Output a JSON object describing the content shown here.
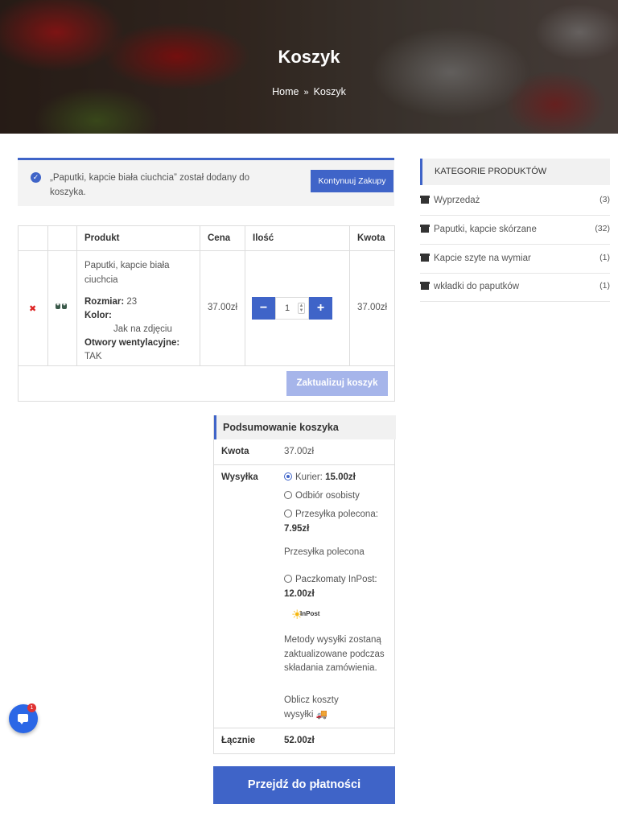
{
  "hero": {
    "title": "Koszyk",
    "breadcrumb": {
      "home": "Home",
      "separator": "»",
      "current": "Koszyk"
    }
  },
  "notice": {
    "message": "„Paputki, kapcie biała ciuchcia” został dodany do koszyka.",
    "button_label": "Kontynuuj Zakupy"
  },
  "cart": {
    "headers": {
      "product": "Produkt",
      "price": "Cena",
      "quantity": "Ilość",
      "amount": "Kwota"
    },
    "item": {
      "name": "Paputki, kapcie biała ciuchcia",
      "size_label": "Rozmiar:",
      "size_value": "23",
      "color_label": "Kolor:",
      "color_value": "Jak na zdjęciu",
      "vent_label": "Otwory wentylacyjne:",
      "vent_value": "TAK",
      "price": "37.00zł",
      "quantity": "1",
      "amount": "37.00zł"
    },
    "update_button": "Zaktualizuj koszyk"
  },
  "summary": {
    "title": "Podsumowanie koszyka",
    "subtotal_label": "Kwota",
    "subtotal_value": "37.00zł",
    "shipping_label": "Wysyłka",
    "options": {
      "courier_label": "Kurier:",
      "courier_price": "15.00zł",
      "pickup_label": "Odbiór osobisty",
      "registered_label": "Przesyłka polecona:",
      "registered_price": "7.95zł",
      "registered_desc": "Przesyłka polecona",
      "inpost_label": "Paczkomaty InPost:",
      "inpost_price": "12.00zł",
      "inpost_logo_text": "InPost"
    },
    "shipping_note": "Metody wysyłki zostaną zaktualizowane podczas składania zamówienia.",
    "calc_shipping": "Oblicz koszty wysyłki",
    "total_label": "Łącznie",
    "total_value": "52.00zł"
  },
  "checkout_button": "Przejdź do płatności",
  "sidebar": {
    "title": "KATEGORIE PRODUKTÓW",
    "categories": [
      {
        "label": "Wyprzedaż",
        "count": "(3)"
      },
      {
        "label": "Paputki, kapcie skórzane",
        "count": "(32)"
      },
      {
        "label": "Kapcie szyte na wymiar",
        "count": "(1)"
      },
      {
        "label": "wkładki do paputków",
        "count": "(1)"
      }
    ]
  },
  "chat": {
    "badge_count": "1"
  },
  "colors": {
    "accent": "#3f64c8",
    "accent_light": "#a6b5ea",
    "remove": "#dd2222",
    "chat": "#2b67e6"
  }
}
